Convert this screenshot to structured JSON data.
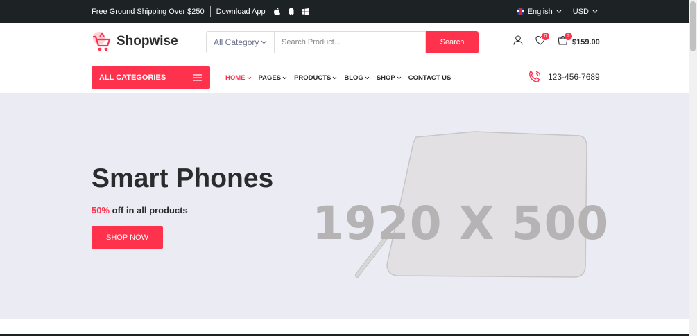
{
  "topbar": {
    "shipping_text": "Free Ground Shipping Over $250",
    "download_text": "Download App",
    "app_icons": [
      "apple-icon",
      "android-icon",
      "windows-icon"
    ],
    "language": "English",
    "currency": "USD"
  },
  "header": {
    "logo_text": "Shopwise",
    "category_select": "All Category",
    "search_placeholder": "Search Product...",
    "search_button": "Search",
    "wishlist_count": "0",
    "cart_count": "2",
    "cart_total": "$159.00"
  },
  "nav": {
    "all_categories": "ALL CATEGORIES",
    "items": [
      {
        "label": "HOME",
        "dropdown": true,
        "active": true
      },
      {
        "label": "PAGES",
        "dropdown": true
      },
      {
        "label": "PRODUCTS",
        "dropdown": true
      },
      {
        "label": "BLOG",
        "dropdown": true
      },
      {
        "label": "SHOP",
        "dropdown": true
      },
      {
        "label": "CONTACT US",
        "dropdown": false
      }
    ],
    "phone": "123-456-7689"
  },
  "hero": {
    "title": "Smart Phones",
    "discount": "50%",
    "subtitle_rest": " off in all products",
    "button": "SHOP NOW",
    "placeholder_text": "1920 X 500"
  },
  "colors": {
    "accent": "#ff324d",
    "topbar_bg": "#1d2224",
    "hero_bg": "#ebebf3"
  }
}
